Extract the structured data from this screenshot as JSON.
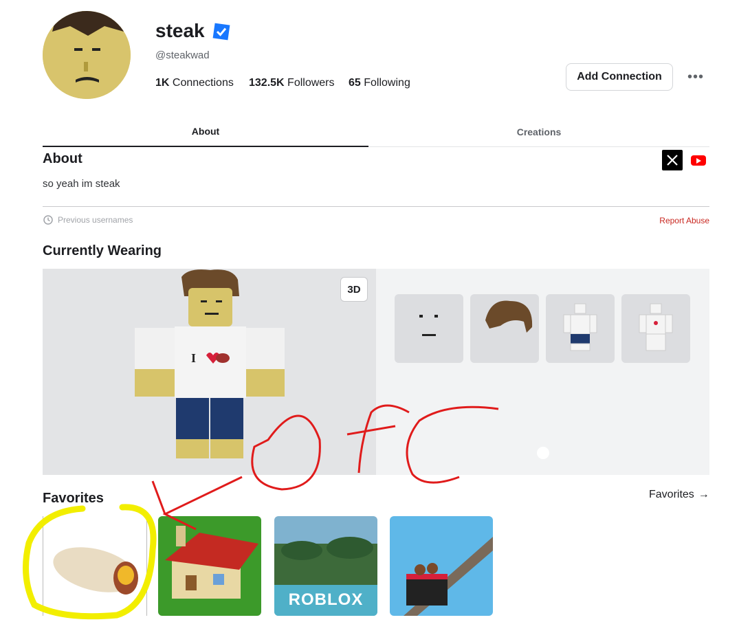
{
  "profile": {
    "display_name": "steak",
    "username": "@steakwad",
    "stats": [
      {
        "value": "1K",
        "label": "Connections"
      },
      {
        "value": "132.5K",
        "label": "Followers"
      },
      {
        "value": "65",
        "label": "Following"
      }
    ],
    "add_connection_label": "Add Connection",
    "more_label": "•••"
  },
  "tabs": [
    {
      "label": "About"
    },
    {
      "label": "Creations"
    }
  ],
  "about": {
    "heading": "About",
    "bio": "so yeah im steak",
    "previous_usernames_label": "Previous usernames",
    "report_abuse_label": "Report Abuse",
    "social_icons": [
      "x-icon",
      "youtube-icon"
    ]
  },
  "currently_wearing": {
    "heading": "Currently Wearing",
    "view_toggle_label": "3D",
    "shirt_text": "I",
    "items": [
      "face-item",
      "hair-item",
      "outfit-item",
      "shirt-item"
    ]
  },
  "favorites": {
    "heading": "Favorites",
    "see_all_label": "Favorites",
    "items": [
      {
        "icon": "burrito"
      },
      {
        "icon": "house"
      },
      {
        "icon": "roblox-landscape",
        "text": "ROBLOX"
      },
      {
        "icon": "cart-ride"
      }
    ]
  },
  "annotation": {
    "text": "ofc",
    "colors": {
      "pen": "#e01b1b",
      "highlight": "#f2ee00"
    }
  }
}
